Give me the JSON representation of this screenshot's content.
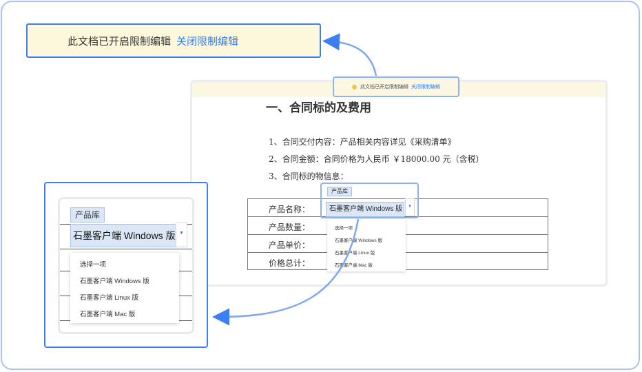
{
  "banner": {
    "text": "此文档已开启限制编辑",
    "link": "关闭限制编辑"
  },
  "document": {
    "heading": "一、合同标的及费用",
    "clauses": [
      "1、合同交付内容：产品相关内容详见《采购清单》",
      "2、合同金额：合同价格为人民币 ￥18000.00 元（含税）",
      "3、合同标的物信息："
    ],
    "table_labels": [
      "产品名称：",
      "产品数量：",
      "产品单价：",
      "价格总计："
    ]
  },
  "product_field": {
    "tag": "产品库",
    "selected": "石墨客户端 Windows 版",
    "options": [
      "选择一项",
      "石墨客户端 Windows 版",
      "石墨客户端 Linux 版",
      "石墨客户端 Mac 版"
    ]
  },
  "colors": {
    "accent": "#3d7ef0",
    "link": "#2f7ef0",
    "banner_bg": "#fdf8dc",
    "frame_border": "#a9c3ec",
    "select_bg": "#dbe7f7"
  }
}
